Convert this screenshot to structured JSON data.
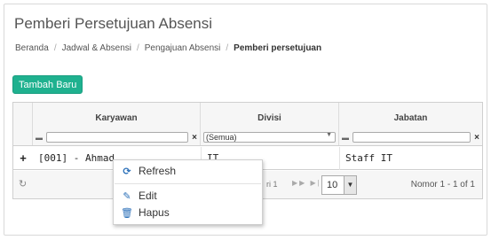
{
  "page": {
    "title": "Pemberi Persetujuan Absensi",
    "breadcrumb": [
      "Beranda",
      "Jadwal & Absensi",
      "Pengajuan Absensi",
      "Pemberi persetujuan"
    ]
  },
  "toolbar": {
    "add_label": "Tambah Baru"
  },
  "grid": {
    "columns": [
      "Karyawan",
      "Divisi",
      "Jabatan"
    ],
    "filters": {
      "karyawan": "",
      "divisi_selected": "(Semua)",
      "jabatan": ""
    },
    "clear_symbol": "×",
    "rows": [
      {
        "expand": "+",
        "karyawan": "[001] - Ahmad",
        "divisi": "IT",
        "jabatan": "Staff IT"
      }
    ],
    "pager": {
      "page_text": "ri 1",
      "rows_per_page": "10",
      "record_text": "Nomor 1 - 1 of 1"
    }
  },
  "context_menu": {
    "items": [
      {
        "label": "Refresh",
        "icon": "refresh-icon"
      },
      {
        "label": "Edit",
        "icon": "edit-icon"
      },
      {
        "label": "Hapus",
        "icon": "trash-icon"
      }
    ]
  },
  "colors": {
    "accent": "#1fb18f",
    "icon_blue": "#2a6fb8"
  }
}
